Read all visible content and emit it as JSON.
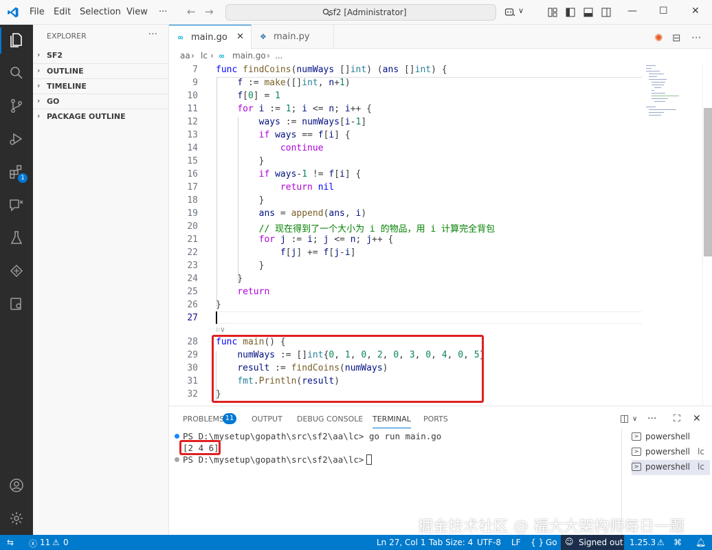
{
  "menu": {
    "file": "File",
    "edit": "Edit",
    "selection": "Selection",
    "view": "View",
    "more": "···"
  },
  "search": {
    "text": "sf2 [Administrator]"
  },
  "sidebar": {
    "title": "EXPLORER",
    "more": "···",
    "sections": [
      "SF2",
      "OUTLINE",
      "TIMELINE",
      "GO",
      "PACKAGE OUTLINE"
    ]
  },
  "activity_badge": "1",
  "tabs": [
    {
      "label": "main.go",
      "icon": "go-file-icon",
      "active": true
    },
    {
      "label": "main.py",
      "icon": "python-file-icon",
      "active": false
    }
  ],
  "breadcrumb": {
    "part1": "aa",
    "part2": "lc",
    "part3": "main.go",
    "part4": "..."
  },
  "editor": {
    "sticky_line_number": "7",
    "line_numbers": [
      "9",
      "10",
      "11",
      "12",
      "13",
      "14",
      "15",
      "16",
      "17",
      "18",
      "19",
      "20",
      "21",
      "22",
      "23",
      "24",
      "25",
      "26",
      "27",
      "28",
      "29",
      "30",
      "31",
      "32"
    ],
    "current_line": "27",
    "codelens": "⚐∨"
  },
  "panel": {
    "tabs": [
      "PROBLEMS",
      "OUTPUT",
      "DEBUG CONSOLE",
      "TERMINAL",
      "PORTS"
    ],
    "problems_count": "11",
    "active_tab": "TERMINAL"
  },
  "terminal": {
    "prompt1": "PS D:\\mysetup\\gopath\\src\\sf2\\aa\\lc>",
    "command": "go run main.go",
    "output": "[2 4 6]",
    "prompt2": "PS D:\\mysetup\\gopath\\src\\sf2\\aa\\lc>"
  },
  "terminal_list": [
    {
      "name": "powershell",
      "suffix": ""
    },
    {
      "name": "powershell",
      "suffix": "lc"
    },
    {
      "name": "powershell",
      "suffix": "lc",
      "selected": true
    }
  ],
  "watermark": "掘金技术社区 @ 福大大架构师每日一题",
  "status": {
    "remote": "⇆",
    "errors": "11",
    "warnings": "0",
    "position": "Ln 27, Col 1",
    "tab_size": "Tab Size: 4",
    "encoding": "UTF-8",
    "eol": "LF",
    "language": "Go",
    "language_braces": "{ }",
    "account": "Signed out",
    "go_version": "1.25.3"
  },
  "colors": {
    "accent": "#0078d4",
    "statusbar": "#007acc",
    "highlight_box": "#e02020"
  }
}
